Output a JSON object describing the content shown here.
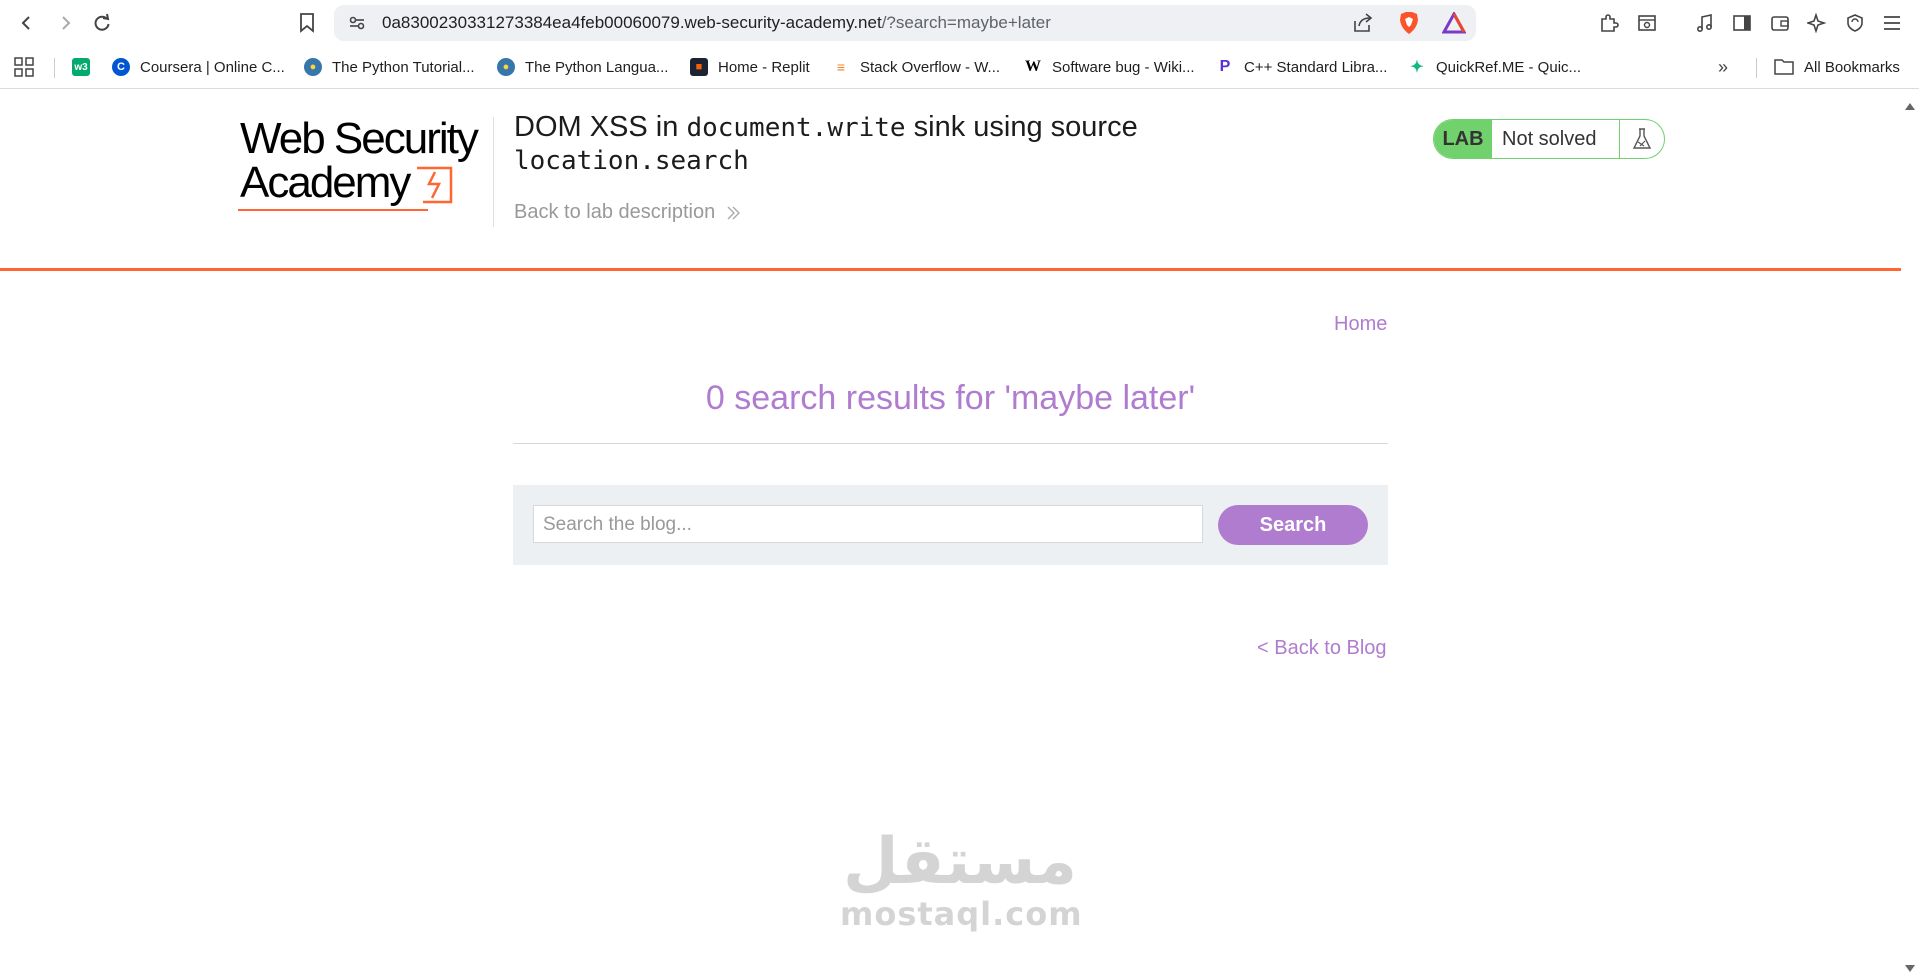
{
  "browser": {
    "url_host": "0a8300230331273384ea4feb00060079.web-security-academy.net",
    "url_path": "/?search=maybe+later",
    "bookmarks": [
      {
        "label": "",
        "icon": "w3schools-icon"
      },
      {
        "label": "Coursera | Online C...",
        "icon": "coursera-icon"
      },
      {
        "label": "The Python Tutorial...",
        "icon": "python-icon"
      },
      {
        "label": "The Python Langua...",
        "icon": "python-icon"
      },
      {
        "label": "Home - Replit",
        "icon": "replit-icon"
      },
      {
        "label": "Stack Overflow - W...",
        "icon": "stackoverflow-icon"
      },
      {
        "label": "Software bug - Wiki...",
        "icon": "wikipedia-icon"
      },
      {
        "label": "C++ Standard Libra...",
        "icon": "cpp-icon"
      },
      {
        "label": "QuickRef.ME - Quic...",
        "icon": "quickref-icon"
      }
    ],
    "all_bookmarks": "All Bookmarks"
  },
  "header": {
    "logo_line1": "Web Security",
    "logo_line2": "Academy",
    "title_part1": "DOM XSS in ",
    "title_code1": "document.write",
    "title_part2": " sink using source",
    "title_code2": "location.search",
    "back_to_lab": "Back to lab description",
    "lab_badge": "LAB",
    "lab_status": "Not solved"
  },
  "nav": {
    "home": "Home"
  },
  "main": {
    "results_heading": "0 search results for 'maybe later'",
    "search_placeholder": "Search the blog...",
    "search_button": "Search",
    "back_to_blog": "< Back to Blog"
  },
  "watermark": {
    "arabic": "مستقل",
    "latin": "mostaql.com"
  },
  "colors": {
    "accent": "#b07ccf",
    "orange": "#ff6633",
    "lab_green": "#70d16d"
  }
}
